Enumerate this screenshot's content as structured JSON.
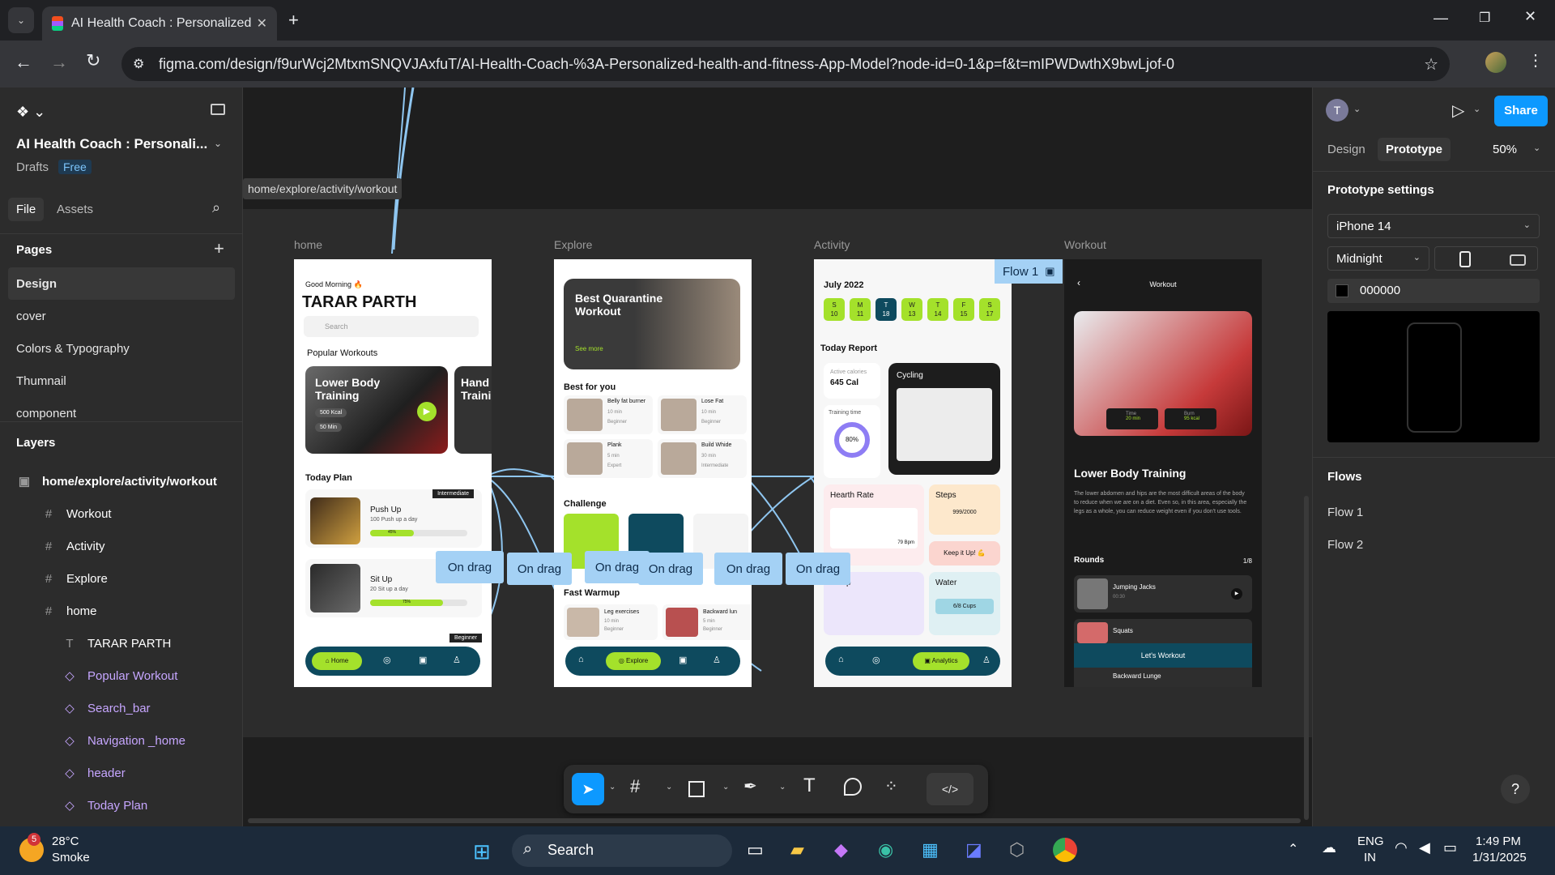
{
  "browser": {
    "tab_title": "AI Health Coach : Personalized",
    "url": "figma.com/design/f9urWcj2MtxmSNQVJAxfuT/AI-Health-Coach-%3A-Personalized-health-and-fitness-App-Model?node-id=0-1&p=f&t=mIPWDwthX9bwLjof-0"
  },
  "left": {
    "file_name": "AI Health Coach : Personali...",
    "drafts": "Drafts",
    "plan_badge": "Free",
    "tab_file": "File",
    "tab_assets": "Assets",
    "pages_title": "Pages",
    "pages": [
      "Design",
      "cover",
      "Colors & Typography",
      "Thumnail",
      "component"
    ],
    "layers_title": "Layers",
    "layers": [
      {
        "label": "home/explore/activity/workout",
        "icon": "frame-icon"
      },
      {
        "label": "Workout",
        "icon": "hash-icon"
      },
      {
        "label": "Activity",
        "icon": "hash-icon"
      },
      {
        "label": "Explore",
        "icon": "hash-icon"
      },
      {
        "label": "home",
        "icon": "hash-icon"
      },
      {
        "label": "TARAR PARTH",
        "icon": "text-icon"
      },
      {
        "label": "Popular Workout",
        "icon": "component-icon"
      },
      {
        "label": "Search_bar",
        "icon": "component-icon"
      },
      {
        "label": "Navigation _home",
        "icon": "component-icon"
      },
      {
        "label": "header",
        "icon": "component-icon"
      },
      {
        "label": "Today Plan",
        "icon": "component-icon"
      }
    ]
  },
  "canvas": {
    "tooltip": "home/explore/activity/workout",
    "frame_labels": [
      "home",
      "Explore",
      "Activity",
      "Workout"
    ],
    "flow_badge": "Flow 1",
    "ondrag": "On drag",
    "home": {
      "greeting": "Good Morning 🔥",
      "name": "TARAR PARTH",
      "search": "Search",
      "popular": "Popular Workouts",
      "card1": "Lower Body Training",
      "card1_kcal": "500 Kcal",
      "card1_min": "50 Min",
      "card2": "Hand Training",
      "today_plan": "Today Plan",
      "badge": "Intermediate",
      "p1": "Push Up",
      "p1_sub": "100 Push up a day",
      "p1_pct": "45%",
      "p2": "Sit Up",
      "p2_sub": "20 Sit up a day",
      "p2_pct": "75%",
      "badge2": "Beginner",
      "nav_home": "Home"
    },
    "explore": {
      "hero": "Best Quarantine Workout",
      "see_more": "See more",
      "best": "Best for you",
      "items": [
        {
          "t": "Belly fat burner",
          "m": "10 min",
          "l": "Beginner"
        },
        {
          "t": "Lose Fat",
          "m": "10 min",
          "l": "Beginner"
        },
        {
          "t": "Plank",
          "m": "5 min",
          "l": "Expert"
        },
        {
          "t": "Build Whide",
          "m": "30 min",
          "l": "Intermediate"
        }
      ],
      "challenge": "Challenge",
      "fast": "Fast Warmup",
      "w1": "Leg exercises",
      "w1m": "10 min",
      "w1l": "Beginner",
      "w2": "Backward lun",
      "w2m": "5 min",
      "w2l": "Beginner",
      "nav": "Explore"
    },
    "activity": {
      "month": "July 2022",
      "days": [
        {
          "d": "S",
          "n": "10"
        },
        {
          "d": "M",
          "n": "11"
        },
        {
          "d": "T",
          "n": "18"
        },
        {
          "d": "W",
          "n": "13"
        },
        {
          "d": "T",
          "n": "14"
        },
        {
          "d": "F",
          "n": "15"
        },
        {
          "d": "S",
          "n": "17"
        }
      ],
      "report": "Today Report",
      "cal_label": "Active calories",
      "cal": "645 Cal",
      "cycling": "Cycling",
      "training": "Training time",
      "pct": "80%",
      "heart": "Hearth Rate",
      "bpm": "79 Bpm",
      "steps": "Steps",
      "steps_val": "999/2000",
      "keep": "Keep it Up! 💪",
      "sleep": "Sleep",
      "water": "Water",
      "cups": "6/8 Cups",
      "nav": "Analytics"
    },
    "workout": {
      "title": "Workout",
      "time_label": "Time",
      "time": "20 min",
      "burn_label": "Burn",
      "burn": "95 kcal",
      "name": "Lower Body Training",
      "desc": "The lower abdomen and hips are the most difficult areas of the body to reduce when we are on a diet. Even so, in this area, especially the legs as a whole, you can reduce weight even if you don't use tools.",
      "rounds": "Rounds",
      "count": "1/8",
      "r1": "Jumping Jacks",
      "r1t": "00:30",
      "r2": "Squats",
      "btn": "Let's Workout",
      "r3": "Backward Lunge"
    }
  },
  "right": {
    "avatar": "T",
    "tab_design": "Design",
    "tab_prototype": "Prototype",
    "zoom": "50%",
    "share": "Share",
    "settings_title": "Prototype settings",
    "device": "iPhone 14",
    "model": "Midnight",
    "color": "000000",
    "flows_title": "Flows",
    "flows": [
      "Flow 1",
      "Flow 2"
    ],
    "help": "?"
  },
  "toolbar": {
    "dev": "</>"
  },
  "taskbar": {
    "badge": "5",
    "temp": "28°C",
    "weather": "Smoke",
    "search": "Search",
    "lang1": "ENG",
    "lang2": "IN",
    "time": "1:49 PM",
    "date": "1/31/2025"
  }
}
